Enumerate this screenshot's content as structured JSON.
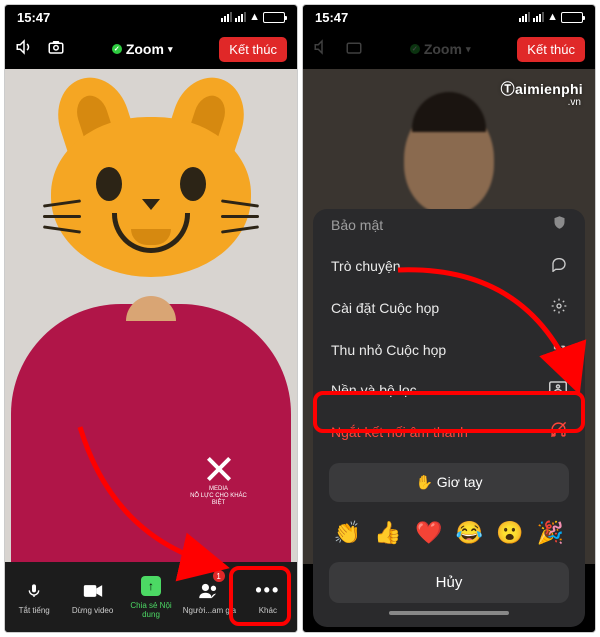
{
  "status": {
    "time": "15:47"
  },
  "header": {
    "zoom_label": "Zoom",
    "end_label": "Kết thúc"
  },
  "tshirt": {
    "brand": "MEDIA",
    "slogan": "NỖ LỰC CHO KHÁC BIỆT"
  },
  "watermark": {
    "brand": "Ⓣaimienphi",
    "tld": ".vn"
  },
  "bottom_bar": {
    "mute": "Tắt tiếng",
    "video": "Dừng video",
    "share": "Chia sẻ Nội dung",
    "participants": "Người...am gia",
    "participants_count": "1",
    "more": "Khác"
  },
  "sheet": {
    "security": "Bảo mật",
    "chat": "Trò chuyện",
    "settings": "Cài đặt Cuộc họp",
    "minimize": "Thu nhỏ Cuộc họp",
    "filters": "Nền và bộ lọc",
    "disconnect": "Ngắt kết nối âm thanh",
    "raise_hand": "Giơ tay",
    "raise_hand_emoji": "✋",
    "cancel": "Hủy",
    "reactions": [
      "👏",
      "👍",
      "❤️",
      "😂",
      "😮",
      "🎉"
    ]
  }
}
